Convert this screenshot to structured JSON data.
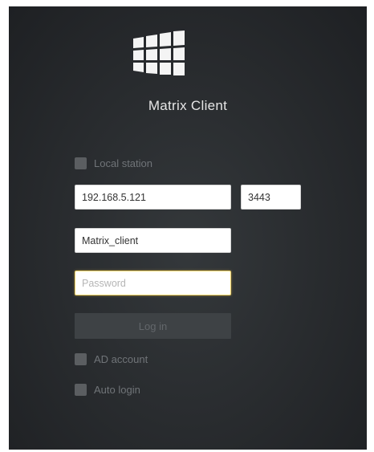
{
  "app": {
    "title": "Matrix Client",
    "logo_icon": "windows-logo-icon"
  },
  "form": {
    "local_station_label": "Local station",
    "local_station_checked": false,
    "server_address": "192.168.5.121",
    "server_port": "3443",
    "username": "Matrix_client",
    "password_value": "",
    "password_placeholder": "Password",
    "login_label": "Log in",
    "ad_account_label": "AD account",
    "ad_account_checked": false,
    "auto_login_label": "Auto login",
    "auto_login_checked": false
  },
  "colors": {
    "background": "#2a2d30",
    "field_focus_border": "#f0d265",
    "checkbox_fill": "#5b5e61",
    "disabled_text": "#707478"
  }
}
